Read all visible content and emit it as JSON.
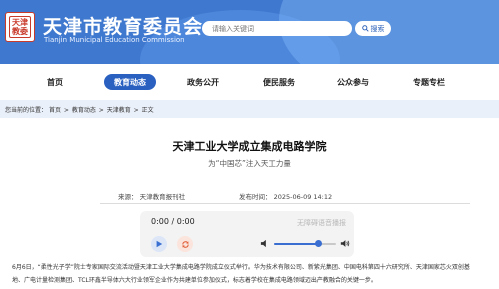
{
  "header": {
    "seal_text": "天津教委",
    "title": "天津市教育委员会",
    "subtitle": "Tianjin Municipal Education Commission",
    "search_placeholder": "请输入关键词",
    "search_button": "搜索"
  },
  "nav": {
    "items": [
      {
        "label": "首页",
        "active": false
      },
      {
        "label": "教育动态",
        "active": true
      },
      {
        "label": "政务公开",
        "active": false
      },
      {
        "label": "便民服务",
        "active": false
      },
      {
        "label": "公众参与",
        "active": false
      },
      {
        "label": "专题专栏",
        "active": false
      }
    ]
  },
  "breadcrumb": {
    "prefix": "您当前的位置：",
    "items": [
      "首页",
      "教育动态",
      "天津教育",
      "正文"
    ],
    "separator": ">"
  },
  "article": {
    "title": "天津工业大学成立集成电路学院",
    "subtitle": "为“中国芯”注入天工力量",
    "source": "来源：  天津教育报刊社",
    "publish_time": "发布时间：  2025-06-09 14:12",
    "paragraph_1": "6月6日，“柔性光子学”院士专家国际交流活动暨天津工业大学集成电路学院成立仪式举行。华为技术有限公司、新紫光集团、中国电科第四十六研究所、天津国家芯火双创基",
    "paragraph_2": "地、广电计量检测集团、TCL环鑫半导体六大行业领军企业作为共建单位参加仪式，标志着学校在集成电路领域迈出产教融合的关键一步。"
  },
  "player": {
    "time": "0:00 / 0:00",
    "powered_by": "无障碍语音播报",
    "volume_level": 0.72,
    "accent_color": "#3a6fd1",
    "play_icon": "play-icon",
    "loop_icon": "loop-icon"
  },
  "colors": {
    "header_bg": "#3f78cf",
    "nav_active": "#2a60c0",
    "breadcrumb_bg": "#eaf0f9"
  }
}
